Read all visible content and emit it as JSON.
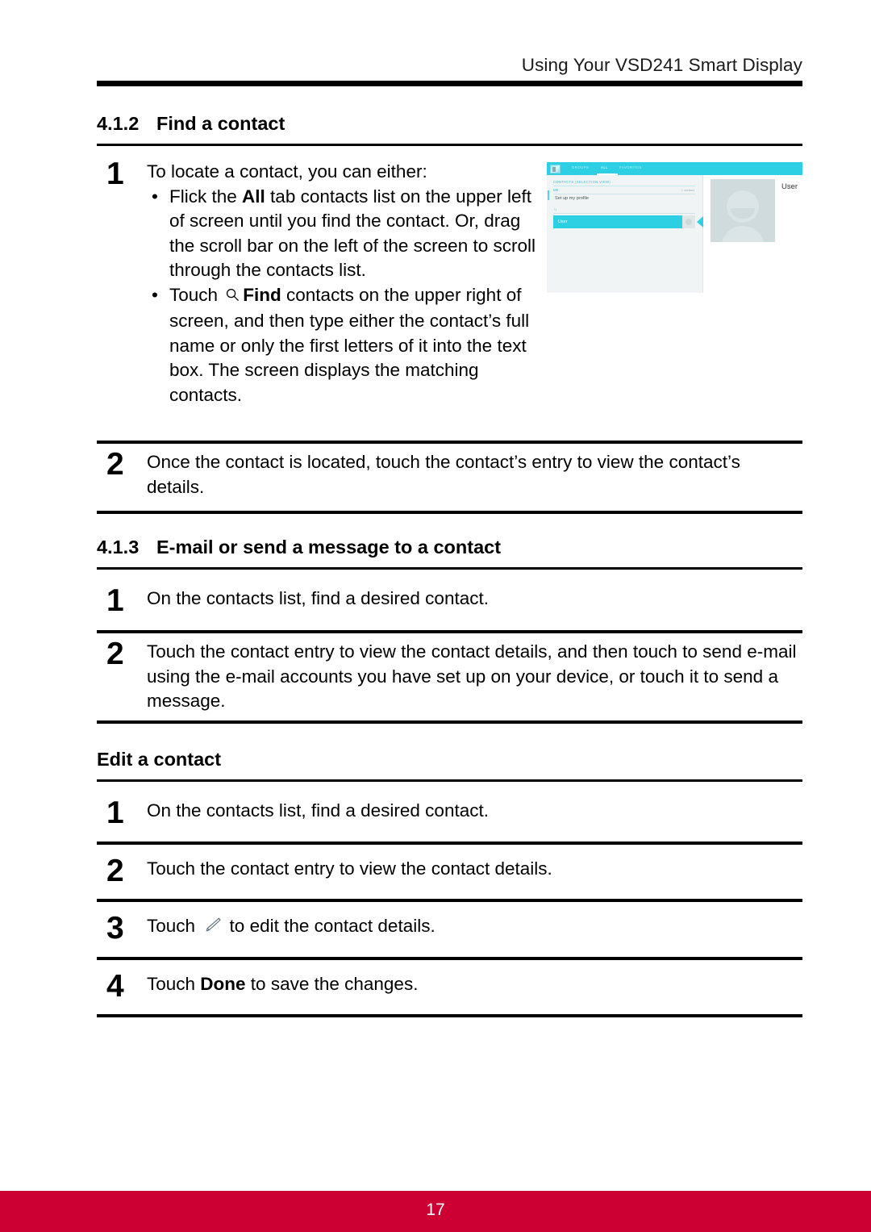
{
  "header": {
    "running_title": "Using Your VSD241 Smart Display"
  },
  "sections": [
    {
      "number": "4.1.2",
      "title": "Find a contact"
    },
    {
      "number": "4.1.3",
      "title": "E-mail or send a message to a contact"
    },
    {
      "number": "",
      "title": "Edit a contact"
    }
  ],
  "steps": {
    "s412_1": {
      "num": "1",
      "intro": "To locate a contact, you can either:",
      "bullet1": {
        "pre": "Flick the ",
        "bold": "All",
        "post": " tab contacts list on the upper left of screen until you find the contact. Or, drag the scroll bar on the left of the screen to scroll through the contacts list."
      },
      "bullet2": {
        "pre": "Touch ",
        "icon": "search-icon",
        "bold": "Find",
        "post": " contacts on the upper right of screen, and then type either the contact’s full name or only the first letters of it into the text box. The screen displays the matching contacts."
      }
    },
    "s412_2": {
      "num": "2",
      "text": "Once the contact is located, touch the contact’s entry to view the contact’s details."
    },
    "s413_1": {
      "num": "1",
      "text": "On the contacts list, find a desired contact."
    },
    "s413_2": {
      "num": "2",
      "text": "Touch the contact entry to view the contact details, and then touch to send e-mail using the e-mail accounts you have set up on your device, or touch it to send a message."
    },
    "edit_1": {
      "num": "1",
      "text": "On the contacts list, find a desired contact."
    },
    "edit_2": {
      "num": "2",
      "text": "Touch the contact entry to view the contact details."
    },
    "edit_3": {
      "num": "3",
      "pre": "Touch ",
      "icon": "pencil-icon",
      "post": " to edit the contact details."
    },
    "edit_4": {
      "num": "4",
      "pre": "Touch ",
      "bold": "Done",
      "post": " to save the changes."
    }
  },
  "screenshot": {
    "tabs": [
      {
        "label": "GROUPS",
        "selected": false
      },
      {
        "label": "ALL",
        "selected": true
      },
      {
        "label": "FAVORITES",
        "selected": false
      }
    ],
    "list_header": "CONTACTS (SELECTION VIEW)",
    "me_label": "ME",
    "contact_count": "1 contact",
    "profile_row": "Set up my profile",
    "section_letter": "U",
    "selected_contact": "User",
    "detail_name": "User",
    "accent_color": "#2dcfe3",
    "panel_color": "#f1f4f4",
    "avatar_color": "#cfdbdd"
  },
  "footer": {
    "page_number": "17",
    "bar_color": "#cc0033"
  }
}
